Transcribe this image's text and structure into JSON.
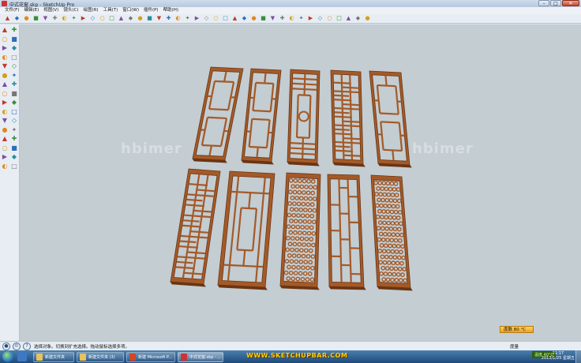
{
  "window": {
    "title": "中式花窗.skp - SketchUp Pro"
  },
  "menus": [
    "文件(F)",
    "编辑(E)",
    "视图(V)",
    "镜头(C)",
    "绘图(R)",
    "工具(T)",
    "窗口(W)",
    "插件(P)",
    "帮助(H)"
  ],
  "toolbar_icons": [
    "select-icon",
    "eraser-icon",
    "paint-icon",
    "rectangle-icon",
    "line-icon",
    "circle-icon",
    "arc-icon",
    "polygon-icon",
    "push-pull-icon",
    "move-icon",
    "rotate-icon",
    "follow-me-icon",
    "scale-icon",
    "offset-icon",
    "tape-icon",
    "dimension-icon",
    "protractor-icon",
    "text-icon",
    "axes-icon",
    "3d-text-icon",
    "orbit-icon",
    "pan-icon",
    "zoom-icon",
    "zoom-window-icon",
    "zoom-extents-icon",
    "previous-icon",
    "next-icon",
    "camera-icon",
    "walk-icon",
    "look-around-icon",
    "section-icon",
    "house-icon",
    "warehouse-icon",
    "share-icon",
    "component-icon",
    "layout-icon",
    "style-icon",
    "shadow-icon",
    "fog-icon"
  ],
  "left_tools": [
    "select-icon",
    "eraser-icon",
    "component-icon",
    "paint-icon",
    "rectangle-icon",
    "line-icon",
    "circle-icon",
    "arc-icon",
    "polygon-icon",
    "freehand-icon",
    "move-icon",
    "push-pull-icon",
    "rotate-icon",
    "follow-me-icon",
    "scale-icon",
    "offset-icon",
    "tape-icon",
    "dimension-icon",
    "protractor-icon",
    "text-icon",
    "axes-icon",
    "3d-text-icon",
    "orbit-icon",
    "pan-icon",
    "zoom-icon",
    "zoom-window-icon",
    "zoom-extents-icon",
    "previous-icon",
    "position-camera-icon",
    "walk-icon",
    "look-around-icon",
    "section-icon"
  ],
  "watermarks": [
    "hbimer",
    "hbimer"
  ],
  "measurements": {
    "label": "度数 80 °C"
  },
  "status": {
    "text": "选择对象。切换到扩充选择。拖动鼠标选择多项。",
    "right_label": "度量"
  },
  "taskbar": {
    "buttons": [
      {
        "label": "新建文件夹"
      },
      {
        "label": "新建文件夹 (3)"
      },
      {
        "label": "新建 Microsoft P..."
      },
      {
        "label": "中式花窗.skp - ..."
      }
    ],
    "banner": "WWW.SKETCHUPBAR.COM",
    "tray_temp": "温度 40°C",
    "clock_time": "21:17",
    "clock_date": "2013/1/25 星期五"
  },
  "colors": {
    "wood": "#a45a28",
    "wood_dark": "#6b3512",
    "viewport": "#c3cdd2"
  }
}
